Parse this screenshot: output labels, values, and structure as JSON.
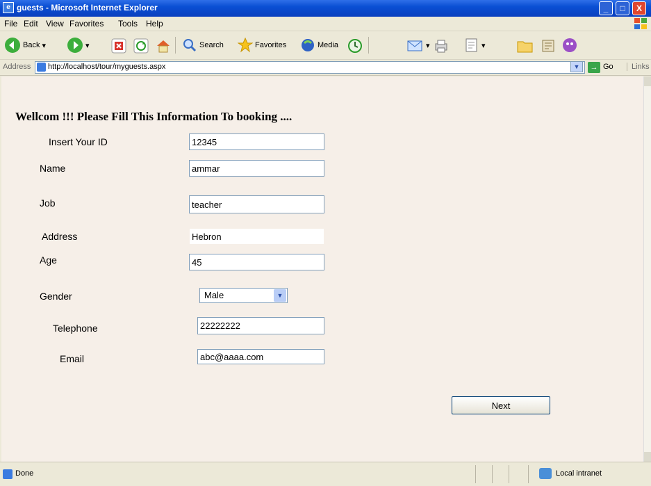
{
  "window": {
    "title": "guests - Microsoft Internet Explorer",
    "minimize": "_",
    "maximize": "□",
    "close": "X"
  },
  "menu": [
    "File",
    "Edit",
    "View",
    "Favorites",
    "Tools",
    "Help"
  ],
  "toolbar": {
    "back_label": "Back",
    "search_label": "Search",
    "favorites_label": "Favorites",
    "media_label": "Media"
  },
  "address": {
    "label": "Address",
    "url": "http://localhost/tour/myguests.aspx",
    "go_label": "Go",
    "links_label": "Links"
  },
  "form": {
    "heading": "Wellcom !!! Please Fill This Information To booking ....",
    "id_label": "Insert Your ID",
    "id_value": "12345",
    "name_label": "Name",
    "name_value": "ammar",
    "job_label": "Job",
    "job_value": "teacher",
    "address_label": "Address",
    "address_value": "Hebron",
    "age_label": "Age",
    "age_value": "45",
    "gender_label": "Gender",
    "gender_value": "Male",
    "telephone_label": "Telephone",
    "telephone_value": "22222222",
    "email_label": "Email",
    "email_value": "abc@aaaa.com",
    "next_label": "Next"
  },
  "status": {
    "text": "Done",
    "zone": "Local intranet"
  },
  "icons": {
    "back": "back-arrow-icon",
    "forward": "forward-arrow-icon",
    "stop": "stop-icon",
    "refresh": "refresh-icon",
    "home": "home-icon",
    "search": "search-icon",
    "favorites": "favorites-star-icon",
    "media": "media-icon",
    "history": "history-icon",
    "mail": "mail-icon",
    "print": "print-icon",
    "edit": "edit-icon",
    "folder": "folder-icon",
    "messenger": "messenger-icon"
  }
}
